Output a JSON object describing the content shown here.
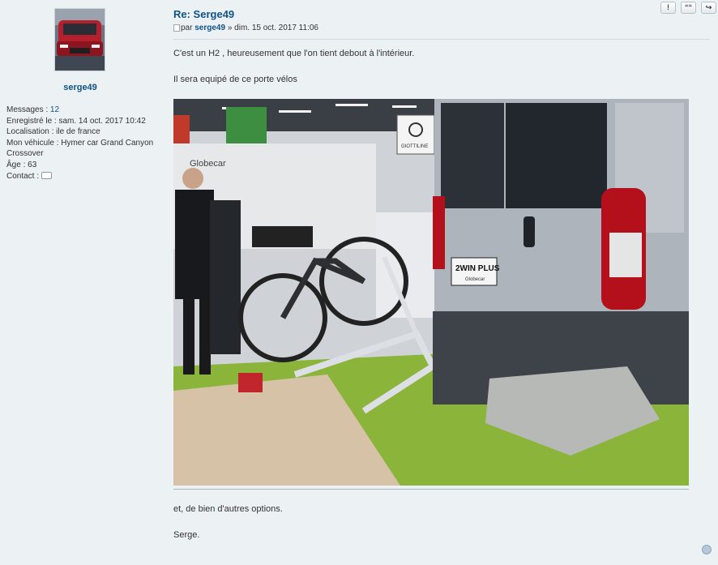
{
  "profile": {
    "username": "serge49",
    "messages_label": "Messages :",
    "messages_count": "12",
    "registered": "Enregistré le : sam. 14 oct. 2017 10:42",
    "location": "Localisation : ile de france",
    "vehicle_line1": "Mon véhicule : Hymer car Grand Canyon",
    "vehicle_line2": "Crossover",
    "age": "Âge : 63",
    "contact_label": "Contact :"
  },
  "post": {
    "title": "Re: Serge49",
    "author_prefix": "par",
    "author": "serge49",
    "date": "» dim. 15 oct. 2017 11:06",
    "line1": "C'est un H2 , heureusement que l'on tient debout à l'intérieur.",
    "line2": "Il sera equipé de ce porte vélos",
    "line3": "et, de bien d'autres options.",
    "line4": "Serge.",
    "photo_text": {
      "globecar": "Globecar",
      "giottiline": "GIOTTILINE",
      "twin_plus": "2WIN PLUS",
      "twin_sub": "Globecar"
    }
  },
  "actions": [
    "!",
    "““",
    "↪"
  ]
}
